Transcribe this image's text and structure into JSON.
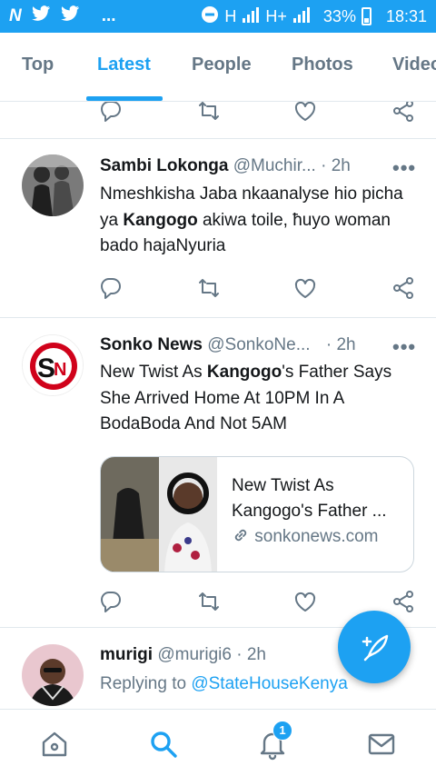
{
  "status_bar": {
    "left_icons": [
      "N",
      "twitter-bird",
      "twitter-bird",
      "..."
    ],
    "network": "H",
    "network2": "H+",
    "battery": "33%",
    "time": "18:31"
  },
  "tabs": [
    "Top",
    "Latest",
    "People",
    "Photos",
    "Videos"
  ],
  "active_tab": "Latest",
  "tweets": [
    {
      "name": "Sambi Lokonga",
      "handle": "@Muchir...",
      "time": "· 2h",
      "text_parts": [
        "Nmeshkisha Jaba nkaanalyse hio picha ya ",
        "Kangogo",
        " akiwa toile, ħuyo woman bado hajaNyuria"
      ]
    },
    {
      "name": "Sonko News",
      "handle": "@SonkoNe...",
      "time": "· 2h",
      "text_parts": [
        "New Twist As ",
        "Kangogo",
        "'s Father Says She Arrived Home At 10PM In A BodaBoda And Not 5AM"
      ],
      "card": {
        "title": "New Twist As Kangogo's Father ...",
        "link": "sonkonews.com"
      }
    },
    {
      "name": "murigi",
      "handle": "@murigi6",
      "time": "· 2h",
      "reply_prefix": "Replying to",
      "reply_to": "@StateHouseKenya"
    }
  ],
  "more_label": "•••",
  "notifications_count": "1",
  "colors": {
    "accent": "#1da1f2",
    "muted": "#657786",
    "divider": "#e1e8ed"
  }
}
